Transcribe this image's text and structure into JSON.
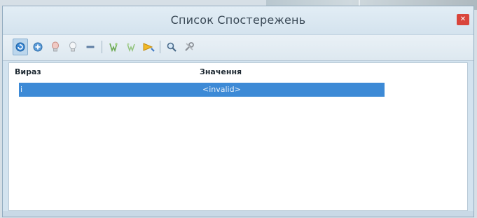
{
  "window": {
    "title": "Список Спостережень",
    "close_icon": "close-icon"
  },
  "toolbar": {
    "buttons": [
      {
        "icon": "refresh-icon",
        "selected": true
      },
      {
        "icon": "add-watch-icon",
        "selected": false
      },
      {
        "icon": "breakpoint-bulb-icon",
        "selected": false
      },
      {
        "icon": "breakpoint-bulb-outline-icon",
        "selected": false
      },
      {
        "icon": "remove-icon",
        "selected": false
      },
      {
        "icon": "step-into-icon",
        "selected": false
      },
      {
        "icon": "step-over-icon",
        "selected": false
      },
      {
        "icon": "step-out-icon",
        "selected": false
      },
      {
        "icon": "clear-icon",
        "selected": false
      },
      {
        "icon": "inspect-icon",
        "selected": false
      },
      {
        "icon": "settings-icon",
        "selected": false
      }
    ]
  },
  "table": {
    "columns": [
      "Вираз",
      "Значення"
    ],
    "rows": [
      {
        "expression": "i",
        "value": "<invalid>",
        "selected": true
      }
    ]
  },
  "colors": {
    "selection": "#3d8ad6",
    "window_background": "#d3e3ef",
    "close_button": "#d9453b"
  }
}
